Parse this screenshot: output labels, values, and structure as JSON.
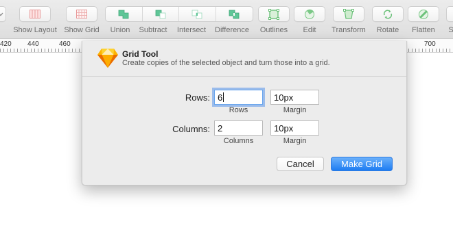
{
  "toolbar": {
    "items": [
      {
        "label": "Show Layout",
        "icon": "layout-columns-icon"
      },
      {
        "label": "Show Grid",
        "icon": "grid-icon"
      },
      {
        "label": "Union",
        "icon": "union-icon"
      },
      {
        "label": "Subtract",
        "icon": "subtract-icon"
      },
      {
        "label": "Intersect",
        "icon": "intersect-icon"
      },
      {
        "label": "Difference",
        "icon": "difference-icon"
      },
      {
        "label": "Outlines",
        "icon": "outlines-icon"
      },
      {
        "label": "Edit",
        "icon": "edit-icon"
      },
      {
        "label": "Transform",
        "icon": "transform-icon"
      },
      {
        "label": "Rotate",
        "icon": "rotate-icon"
      },
      {
        "label": "Flatten",
        "icon": "flatten-icon"
      }
    ]
  },
  "ruler": {
    "numbers": [
      "420",
      "440",
      "460",
      "700"
    ]
  },
  "dialog": {
    "title": "Grid Tool",
    "subtitle": "Create copies of the selected object and turn those into a grid.",
    "rows_label": "Rows:",
    "rows_value": "6",
    "rows_caption": "Rows",
    "rows_margin_value": "10px",
    "rows_margin_caption": "Margin",
    "columns_label": "Columns:",
    "columns_value": "2",
    "columns_caption": "Columns",
    "columns_margin_value": "10px",
    "columns_margin_caption": "Margin",
    "cancel_label": "Cancel",
    "primary_label": "Make Grid"
  },
  "colors": {
    "accent": "#1d7cf2",
    "focus_ring": "#5a96eb",
    "boolean_icon": "#4fc08f",
    "outline_icon": "#6cc17a"
  }
}
